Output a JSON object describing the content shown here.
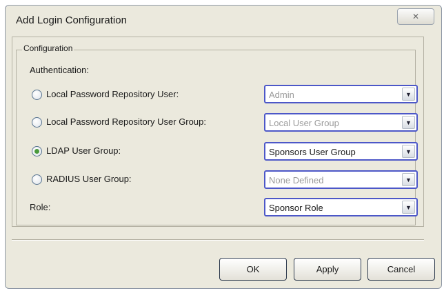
{
  "dialog": {
    "title": "Add Login Configuration",
    "close_glyph": "✕"
  },
  "configuration": {
    "legend": "Configuration",
    "authentication_label": "Authentication:",
    "options": [
      {
        "label": "Local Password Repository User:",
        "selected": false,
        "value": "Admin",
        "enabled": false
      },
      {
        "label": "Local Password Repository User Group:",
        "selected": false,
        "value": "Local User Group",
        "enabled": false
      },
      {
        "label": "LDAP User Group:",
        "selected": true,
        "value": "Sponsors User Group",
        "enabled": true
      },
      {
        "label": "RADIUS User Group:",
        "selected": false,
        "value": "None Defined",
        "enabled": false
      }
    ],
    "role": {
      "label": "Role:",
      "value": "Sponsor Role"
    },
    "dropdown_glyph": "▼"
  },
  "buttons": {
    "ok": "OK",
    "apply": "Apply",
    "cancel": "Cancel"
  },
  "colors": {
    "dialog_bg": "#ebe9dd",
    "combo_border": "#4c57c8",
    "radio_checked": "#4a9a3c"
  }
}
